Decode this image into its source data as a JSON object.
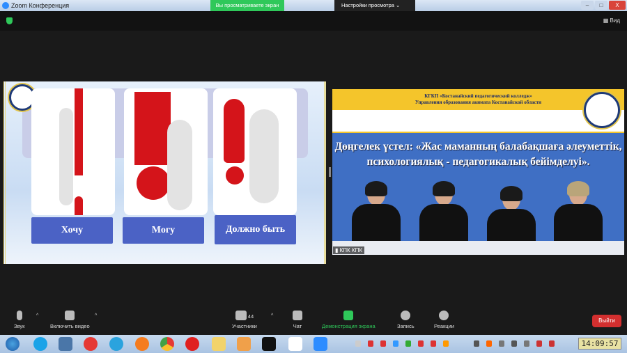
{
  "window": {
    "title": "Zoom Конференция",
    "viewing_banner": "Вы просматриваете экран КПК КПК",
    "view_settings": "Настройки просмотра",
    "view_settings_chevron": "⌄",
    "view_button": "Вид",
    "minimize": "–",
    "maximize": "□",
    "close": "X"
  },
  "slide": {
    "labels": [
      "Хочу",
      "Могу",
      "Должно быть"
    ],
    "colors": {
      "label_bg": "#4b62c5",
      "exclamation": "#d4141a"
    }
  },
  "video": {
    "header_line1": "КГКП «Костанайский педагогический колледж»",
    "header_line2": "Управления образования акимата Костанайской области",
    "title": "Дөңгелек үстел: «Жас маманның балабақшаға әлеуметтік, психологиялық - педагогикалық бейімделуі».",
    "participant_name": "КПК КПК"
  },
  "toolbar": {
    "audio": "Звук",
    "video": "Включить видео",
    "participants": "Участники",
    "participants_count": "44",
    "chat": "Чат",
    "share": "Демонстрация экрана",
    "record": "Запись",
    "reactions": "Реакции",
    "leave": "Выйти",
    "caret": "^",
    "share_color": "#2fc85a"
  },
  "taskbar": {
    "apps": [
      "windows-start",
      "skype",
      "vk",
      "yandex",
      "telegram",
      "firefox",
      "chrome",
      "opera",
      "explorer",
      "media-player",
      "tiktok",
      "yandex-browser",
      "zoom"
    ],
    "clock": "14:09:57"
  }
}
